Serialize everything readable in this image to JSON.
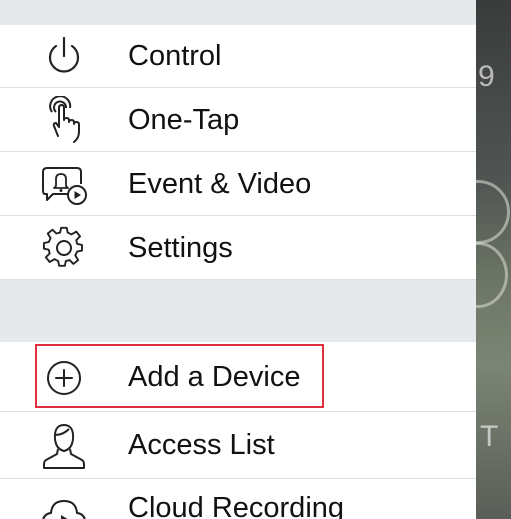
{
  "menu": {
    "items": [
      {
        "label": "Control",
        "icon": "power-icon"
      },
      {
        "label": "One-Tap",
        "icon": "tap-hand-icon"
      },
      {
        "label": "Event & Video",
        "icon": "event-video-icon"
      },
      {
        "label": "Settings",
        "icon": "gear-icon"
      }
    ],
    "items2": [
      {
        "label": "Add a Device",
        "icon": "plus-circle-icon"
      },
      {
        "label": "Access List",
        "icon": "user-icon"
      },
      {
        "label": "Cloud Recording",
        "icon": "cloud-play-icon"
      }
    ]
  },
  "backdrop": {
    "glyph_1": "9",
    "glyph_2": "T"
  },
  "colors": {
    "highlight": "#e0303d",
    "section_gray": "#e6e9ec",
    "text": "#111111"
  }
}
